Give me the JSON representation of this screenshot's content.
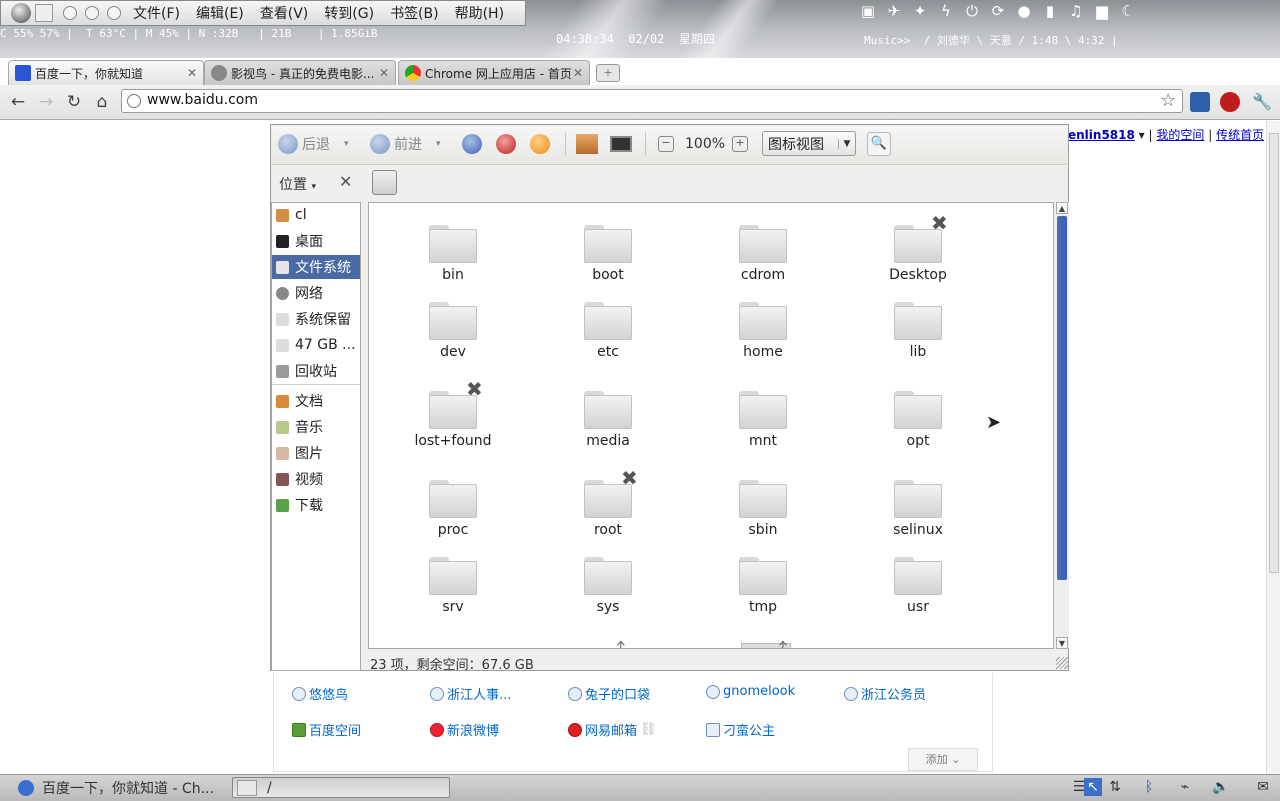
{
  "desktop": {
    "menu": [
      "文件(F)",
      "编辑(E)",
      "查看(V)",
      "转到(G)",
      "书签(B)",
      "帮助(H)"
    ],
    "sysmon": "C 55% 57% |  T 63°C | M 45% | N :32B   | 21B    | 1.85GiB",
    "clock": "04:38:34  02/02  星期四",
    "music": "Music>>  / 刘德华 \\ 天意 / 1:48 \\ 4:32 |"
  },
  "browser": {
    "tabs": [
      {
        "title": "百度一下，你就知道",
        "active": true
      },
      {
        "title": "影视鸟 - 真正的免费电影...",
        "active": false
      },
      {
        "title": "Chrome 网上应用店 - 首页",
        "active": false
      }
    ],
    "url": "www.baidu.com"
  },
  "page": {
    "user": "enlin5818",
    "links_top": [
      "我的空间",
      "传统首页"
    ],
    "row1": [
      "悠悠鸟",
      "浙江人事...",
      "兔子的口袋",
      "gnomelook",
      "浙江公务员"
    ],
    "row2": [
      "百度空间",
      "新浪微博",
      "网易邮箱",
      "刁蛮公主"
    ],
    "add_label": "添加"
  },
  "filemanager": {
    "back": "后退",
    "forward": "前进",
    "zoom": "100%",
    "view": "图标视图",
    "location_label": "位置",
    "sidebar": [
      {
        "label": "cl",
        "selected": false
      },
      {
        "label": "桌面",
        "selected": false
      },
      {
        "label": "文件系统",
        "selected": true
      },
      {
        "label": "网络",
        "selected": false
      },
      {
        "label": "系统保留",
        "selected": false
      },
      {
        "label": "47 GB ...",
        "selected": false
      },
      {
        "label": "回收站",
        "selected": false
      },
      {
        "label": "文档",
        "selected": false
      },
      {
        "label": "音乐",
        "selected": false
      },
      {
        "label": "图片",
        "selected": false
      },
      {
        "label": "视频",
        "selected": false
      },
      {
        "label": "下载",
        "selected": false
      }
    ],
    "folders": [
      [
        "bin",
        "boot",
        "cdrom",
        "Desktop"
      ],
      [
        "dev",
        "etc",
        "home",
        "lib"
      ],
      [
        "lost+found",
        "media",
        "mnt",
        "opt"
      ],
      [
        "proc",
        "root",
        "sbin",
        "selinux"
      ],
      [
        "srv",
        "sys",
        "tmp",
        "usr"
      ]
    ],
    "status": "23 项，剩余空间：67.6 GB"
  },
  "taskbar": {
    "task1": "百度一下，你就知道 - Ch...",
    "task2": "/"
  },
  "colors": {
    "selection": "#4a6aa5",
    "scroll_thumb": "#3a5bb0",
    "link": "#0066cc"
  }
}
